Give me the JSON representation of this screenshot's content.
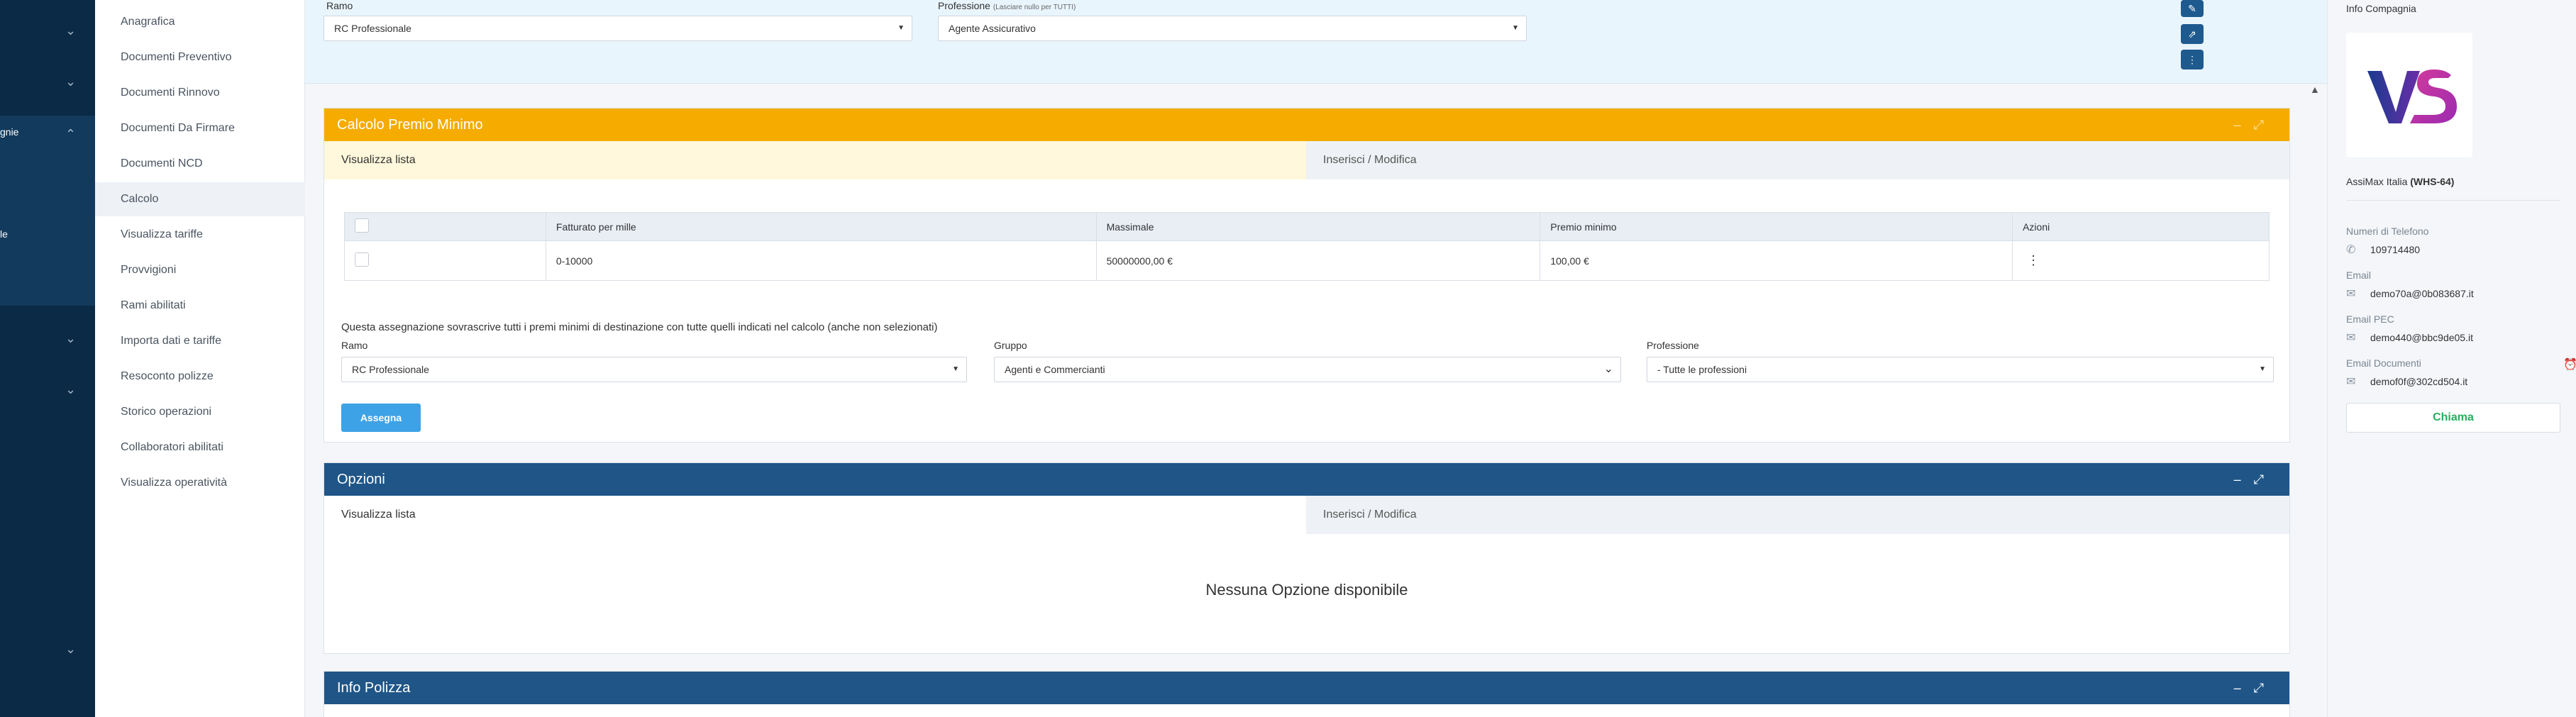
{
  "darknav": {
    "label_fragment": "gnie",
    "label_fragment2": "le"
  },
  "submenu": {
    "items": [
      {
        "label": "Anagrafica"
      },
      {
        "label": "Documenti Preventivo"
      },
      {
        "label": "Documenti Rinnovo"
      },
      {
        "label": "Documenti Da Firmare"
      },
      {
        "label": "Documenti NCD"
      },
      {
        "label": "Calcolo"
      },
      {
        "label": "Visualizza tariffe"
      },
      {
        "label": "Provvigioni"
      },
      {
        "label": "Rami abilitati"
      },
      {
        "label": "Importa dati e tariffe"
      },
      {
        "label": "Resoconto polizze"
      },
      {
        "label": "Storico operazioni"
      },
      {
        "label": "Collaboratori abilitati"
      },
      {
        "label": "Visualizza operatività"
      }
    ]
  },
  "topfilter": {
    "ramo_label": "Ramo",
    "ramo_value": "RC Professionale",
    "professione_label": "Professione",
    "professione_hint": "(Lasciare nullo per TUTTI)",
    "professione_value": "Agente Assicurativo"
  },
  "calcolo": {
    "title": "Calcolo Premio Minimo",
    "tab_list": "Visualizza lista",
    "tab_edit": "Inserisci / Modifica",
    "columns": [
      "Fatturato per mille",
      "Massimale",
      "Premio minimo",
      "Azioni"
    ],
    "rows": [
      {
        "fatturato": "0-10000",
        "massimale": "50000000,00 €",
        "premio": "100,00 €"
      }
    ],
    "assign_note": "Questa assegnazione sovrascrive tutti i premi minimi di destinazione con tutte quelli indicati nel calcolo (anche non selezionati)",
    "ramo_label": "Ramo",
    "ramo_value": "RC Professionale",
    "gruppo_label": "Gruppo",
    "gruppo_value": "Agenti e Commercianti",
    "professione_label": "Professione",
    "professione_value": "- Tutte le professioni",
    "assign_button": "Assegna"
  },
  "opzioni": {
    "title": "Opzioni",
    "tab_list": "Visualizza lista",
    "tab_edit": "Inserisci / Modifica",
    "empty": "Nessuna Opzione disponibile"
  },
  "info_polizza": {
    "title": "Info Polizza"
  },
  "company": {
    "heading": "Info Compagnia",
    "name": "AssiMax Italia",
    "code": "(WHS-64)",
    "phone_label": "Numeri di Telefono",
    "phone": "109714480",
    "email_label": "Email",
    "email": "demo70a@0b083687.it",
    "pec_label": "Email PEC",
    "pec": "demo440@bbc9de05.it",
    "docs_label": "Email Documenti",
    "docs_email": "demof0f@302cd504.it",
    "call_button": "Chiama"
  },
  "colors": {
    "nav_dark": "#0b2a45",
    "calcolo_header": "#f5ab00",
    "panel_blue": "#1f5587",
    "accent_button": "#3ea2e6",
    "call_green": "#27ae60",
    "tab_active_yellow": "#fff8dc"
  }
}
